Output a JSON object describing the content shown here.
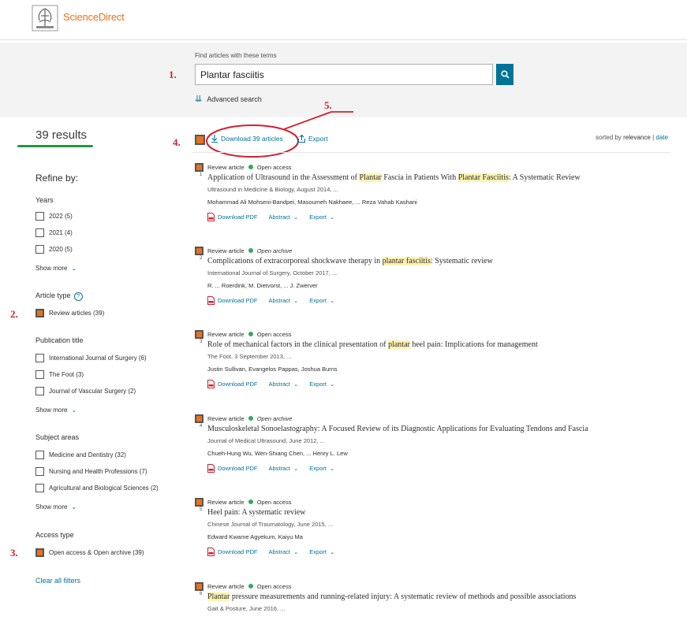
{
  "brand": "ScienceDirect",
  "search": {
    "label": "Find articles with these terms",
    "value": "Plantar fasciitis",
    "advanced": "Advanced search"
  },
  "annotations": [
    "1.",
    "2.",
    "3.",
    "4.",
    "5."
  ],
  "left": {
    "results": "39 results",
    "refine": "Refine by:",
    "years_title": "Years",
    "years": [
      "2022 (5)",
      "2021 (4)",
      "2020 (5)"
    ],
    "show_more": "Show more",
    "article_type_title": "Article type",
    "article_type_info": "?",
    "article_types": [
      "Review articles (39)"
    ],
    "publication_title": "Publication title",
    "publications": [
      "International Journal of Surgery (6)",
      "The Foot (3)",
      "Journal of Vascular Surgery (2)"
    ],
    "subject_title": "Subject areas",
    "subjects": [
      "Medicine and Dentistry (32)",
      "Nursing and Health Professions (7)",
      "Agricultural and Biological Sciences (2)"
    ],
    "access_title": "Access type",
    "access": [
      "Open access & Open archive (39)"
    ],
    "clear": "Clear all filters"
  },
  "toolbar": {
    "download_all": "Download 39 articles",
    "export": "Export",
    "sorted_by": "sorted by",
    "relevance": "relevance",
    "sep": "|",
    "date": "date"
  },
  "colors": {
    "accent": "#007398",
    "brand": "#e9711c",
    "annotation": "#d0202e",
    "open_access": "#3aa55d"
  },
  "results": [
    {
      "type": "Review article",
      "access": "Open access",
      "num": "1",
      "title_parts": [
        [
          "Application of Ultrasound in the Assessment of ",
          false
        ],
        [
          "Plantar",
          true
        ],
        [
          " Fascia in Patients With ",
          false
        ],
        [
          "Plantar Fasciitis",
          true
        ],
        [
          ": A Systematic Review",
          false
        ]
      ],
      "source": "Ultrasound in Medicine & Biology, August 2014, ...",
      "authors": "Mohammad Ali Mohseni-Bandpei, Masoumeh Nakhaee, ... Reza Vahab Kashani",
      "download": "Download PDF",
      "abstract": "Abstract",
      "export": "Export"
    },
    {
      "type": "Review article",
      "access": "Open archive",
      "num": "2",
      "title_parts": [
        [
          "Complications of extracorporeal shockwave therapy in ",
          false
        ],
        [
          "plantar fasciitis",
          true
        ],
        [
          ": Systematic review",
          false
        ]
      ],
      "source": "International Journal of Surgery, October 2017, ...",
      "authors": "R. ... Roerdink, M. Dietvorst, ... J. Zwerver",
      "download": "Download PDF",
      "abstract": "Abstract",
      "export": "Export"
    },
    {
      "type": "Review article",
      "access": "Open access",
      "num": "3",
      "title_parts": [
        [
          "Role of mechanical factors in the clinical presentation of ",
          false
        ],
        [
          "plantar",
          true
        ],
        [
          " heel pain: Implications for management",
          false
        ]
      ],
      "source": "The Foot, 3 September 2013, ...",
      "authors": "Justin Sullivan, Evangelos Pappas, Joshua Burns",
      "download": "Download PDF",
      "abstract": "Abstract",
      "export": "Export"
    },
    {
      "type": "Review article",
      "access": "Open archive",
      "num": "4",
      "title_parts": [
        [
          "Musculoskeletal Sonoelastography: A Focused Review of its Diagnostic Applications for Evaluating Tendons and Fascia",
          false
        ]
      ],
      "source": "Journal of Medical Ultrasound, June 2012, ...",
      "authors": "Chueh-Hung Wu, Wen-Shiang Chen, ... Henry L. Lew",
      "download": "Download PDF",
      "abstract": "Abstract",
      "export": "Export"
    },
    {
      "type": "Review article",
      "access": "Open access",
      "num": "5",
      "title_parts": [
        [
          "Heel pain: A systematic review",
          false
        ]
      ],
      "source": "Chinese Journal of Traumatology, June 2015, ...",
      "authors": "Edward Kwame Agyekum, Kaiyu Ma",
      "download": "Download PDF",
      "abstract": "Abstract",
      "export": "Export"
    },
    {
      "type": "Review article",
      "access": "Open access",
      "num": "6",
      "title_parts": [
        [
          "Plantar",
          true
        ],
        [
          " pressure measurements and running-related injury: A systematic review of methods and possible associations",
          false
        ]
      ],
      "source": "Gait & Posture, June 2016, ...",
      "authors": "",
      "download": "",
      "abstract": "",
      "export": ""
    }
  ]
}
